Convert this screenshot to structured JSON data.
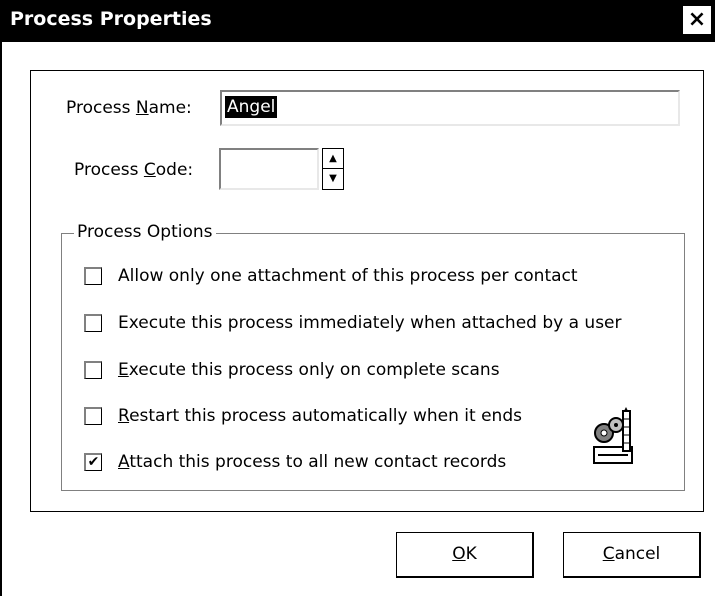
{
  "window": {
    "title": "Process Properties",
    "close_label": "×"
  },
  "form": {
    "name_label_pre": "Process ",
    "name_label_accel": "N",
    "name_label_post": "ame:",
    "name_value": "Angel",
    "code_label_pre": "Process ",
    "code_label_accel": "C",
    "code_label_post": "ode:",
    "code_value": ""
  },
  "options": {
    "legend": "Process Options",
    "items": [
      {
        "pre": "",
        "accel": "",
        "post": "Allow only one attachment of this process per contact",
        "checked": false
      },
      {
        "pre": "",
        "accel": "",
        "post": "Execute this process immediately when attached by a user",
        "checked": false
      },
      {
        "pre": "",
        "accel": "E",
        "post": "xecute this process only on complete scans",
        "checked": false
      },
      {
        "pre": "",
        "accel": "R",
        "post": "estart this process automatically when it ends",
        "checked": false
      },
      {
        "pre": "",
        "accel": "A",
        "post": "ttach this process to all new contact records",
        "checked": true
      }
    ]
  },
  "buttons": {
    "ok_accel": "O",
    "ok_post": "K",
    "cancel_accel": "C",
    "cancel_post": "ancel"
  },
  "icons": {
    "close": "close-icon",
    "spin_up": "spin-up-arrow-icon",
    "spin_down": "spin-down-arrow-icon",
    "wizard": "process-wizard-icon"
  }
}
